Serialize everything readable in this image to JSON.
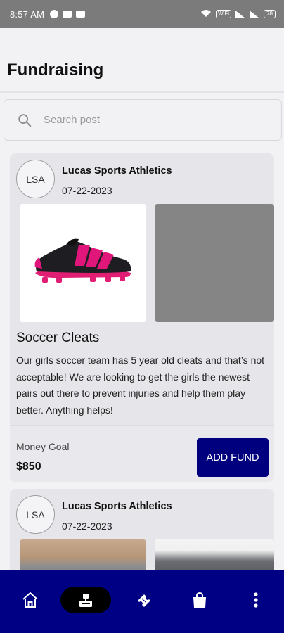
{
  "status_bar": {
    "time": "8:57 AM",
    "battery": "78"
  },
  "header": {
    "title": "Fundraising"
  },
  "search": {
    "placeholder": "Search post"
  },
  "posts": [
    {
      "avatar": "LSA",
      "org": "Lucas Sports Athletics",
      "date": "07-22-2023",
      "title": "Soccer Cleats",
      "description": "Our girls soccer team has 5 year old cleats and that’s not acceptable! We are looking to get the girls the newest pairs out there to prevent injuries and help them play better. Anything helps!",
      "goal_label": "Money Goal",
      "goal_amount": "$850",
      "button_label": "ADD FUND"
    },
    {
      "avatar": "LSA",
      "org": "Lucas Sports Athletics",
      "date": "07-22-2023"
    }
  ],
  "nav": {
    "items": [
      "home-icon",
      "fundraising-icon",
      "ticket-icon",
      "shopping-bag-icon",
      "more-vertical-icon"
    ],
    "active": "fundraising-icon"
  },
  "colors": {
    "accent": "#00007f",
    "nav_bg": "#000085",
    "card_bg": "#e6e6ea"
  }
}
